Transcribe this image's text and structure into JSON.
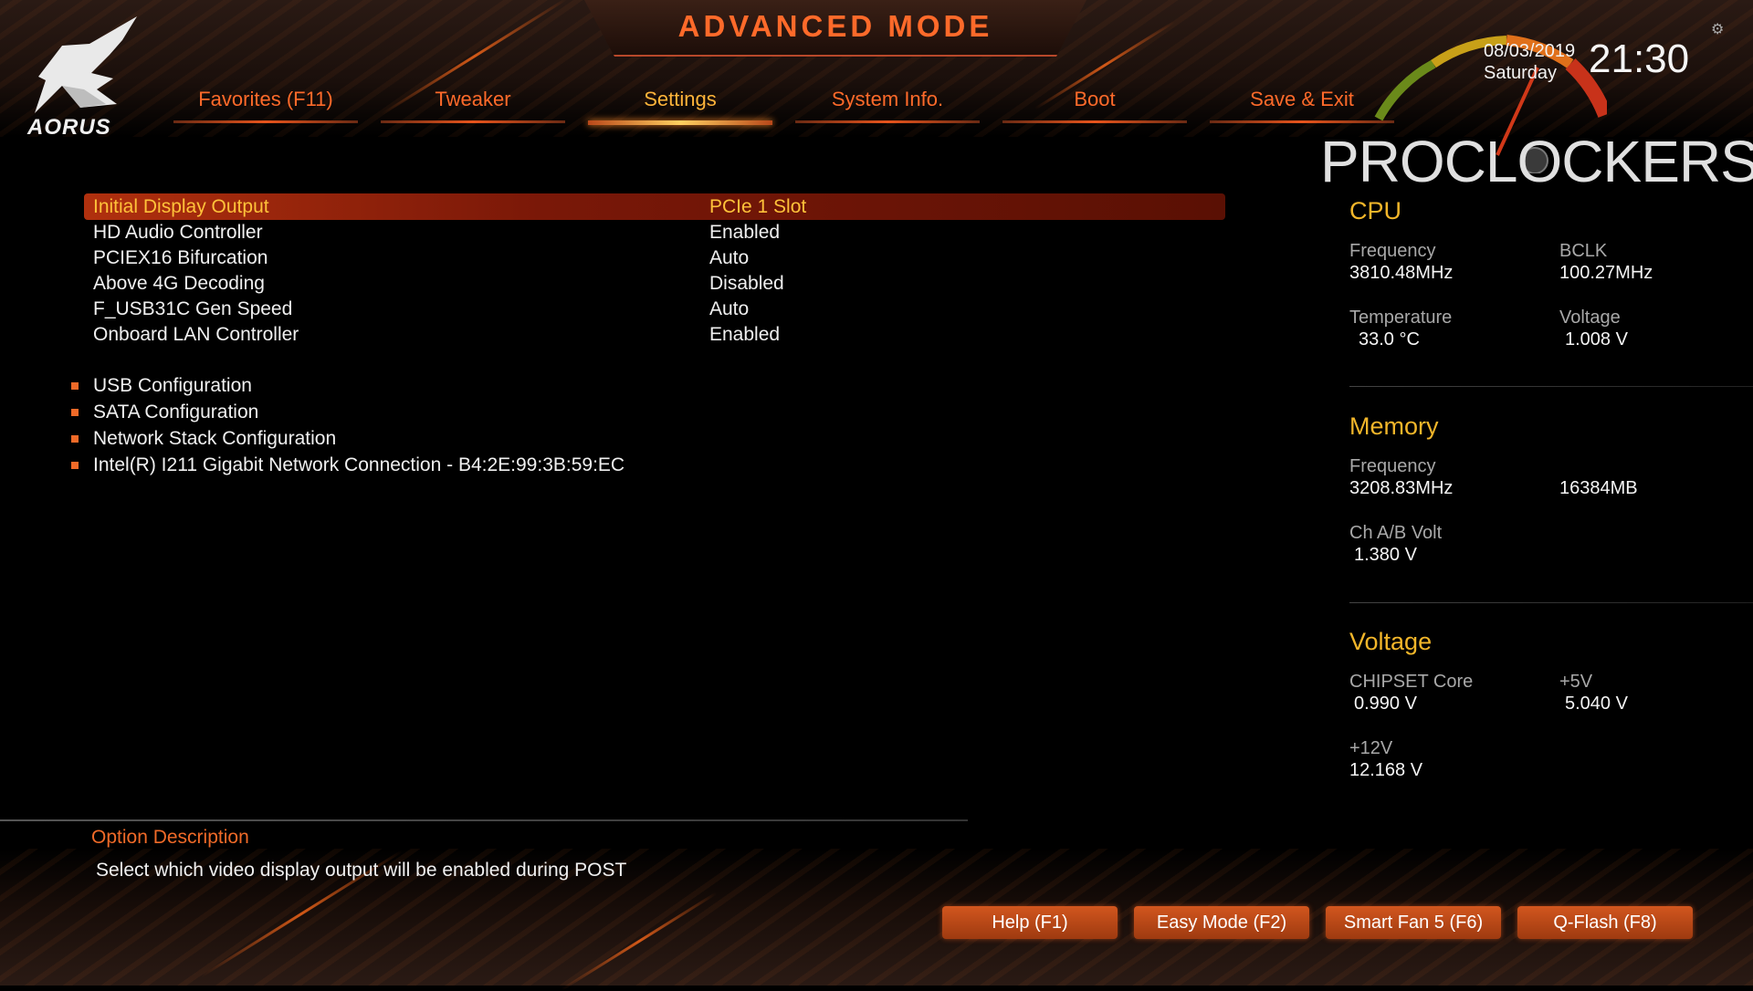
{
  "header": {
    "title": "ADVANCED MODE",
    "brand": "AORUS",
    "date": "08/03/2019",
    "day": "Saturday",
    "time": "21:30",
    "watermark": "PROCLOCKERS"
  },
  "tabs": [
    {
      "label": "Favorites (F11)"
    },
    {
      "label": "Tweaker"
    },
    {
      "label": "Settings",
      "active": true
    },
    {
      "label": "System Info."
    },
    {
      "label": "Boot"
    },
    {
      "label": "Save & Exit"
    }
  ],
  "settings": [
    {
      "label": "Initial Display Output",
      "value": "PCIe 1 Slot",
      "selected": true
    },
    {
      "label": "HD Audio Controller",
      "value": "Enabled"
    },
    {
      "label": "PCIEX16 Bifurcation",
      "value": "Auto"
    },
    {
      "label": "Above 4G Decoding",
      "value": "Disabled"
    },
    {
      "label": "F_USB31C Gen Speed",
      "value": "Auto"
    },
    {
      "label": "Onboard LAN Controller",
      "value": "Enabled"
    }
  ],
  "submenus": [
    {
      "label": "USB Configuration"
    },
    {
      "label": "SATA Configuration"
    },
    {
      "label": "Network Stack Configuration"
    },
    {
      "label": "Intel(R) I211 Gigabit  Network Connection - B4:2E:99:3B:59:EC"
    }
  ],
  "description": {
    "title": "Option Description",
    "text": "Select which video display output will be enabled during POST"
  },
  "panel": {
    "cpu": {
      "title": "CPU",
      "frequency_label": "Frequency",
      "frequency": "3810.48MHz",
      "bclk_label": "BCLK",
      "bclk": "100.27MHz",
      "temperature_label": "Temperature",
      "temperature": "33.0 °C",
      "voltage_label": "Voltage",
      "voltage": "1.008 V"
    },
    "memory": {
      "title": "Memory",
      "frequency_label": "Frequency",
      "frequency": "3208.83MHz",
      "size": "16384MB",
      "volt_label": "Ch A/B Volt",
      "volt": "1.380 V"
    },
    "voltage": {
      "title": "Voltage",
      "chipset_label": "CHIPSET Core",
      "chipset": "0.990 V",
      "p5v_label": "+5V",
      "p5v": "5.040 V",
      "p12v_label": "+12V",
      "p12v": "12.168 V"
    }
  },
  "buttons": {
    "help": "Help (F1)",
    "easy": "Easy Mode (F2)",
    "fan": "Smart Fan 5 (F6)",
    "qflash": "Q-Flash (F8)"
  },
  "colors": {
    "accent": "#ff6a2a",
    "active_tab": "#ffb43a",
    "section_title": "#f2b62a",
    "selected_row": "#7a1808"
  },
  "icons": {
    "logo": "aorus-eagle-icon",
    "gear": "gear-icon",
    "bullet": "square-bullet-icon",
    "gauge": "speedometer-gauge-icon"
  }
}
